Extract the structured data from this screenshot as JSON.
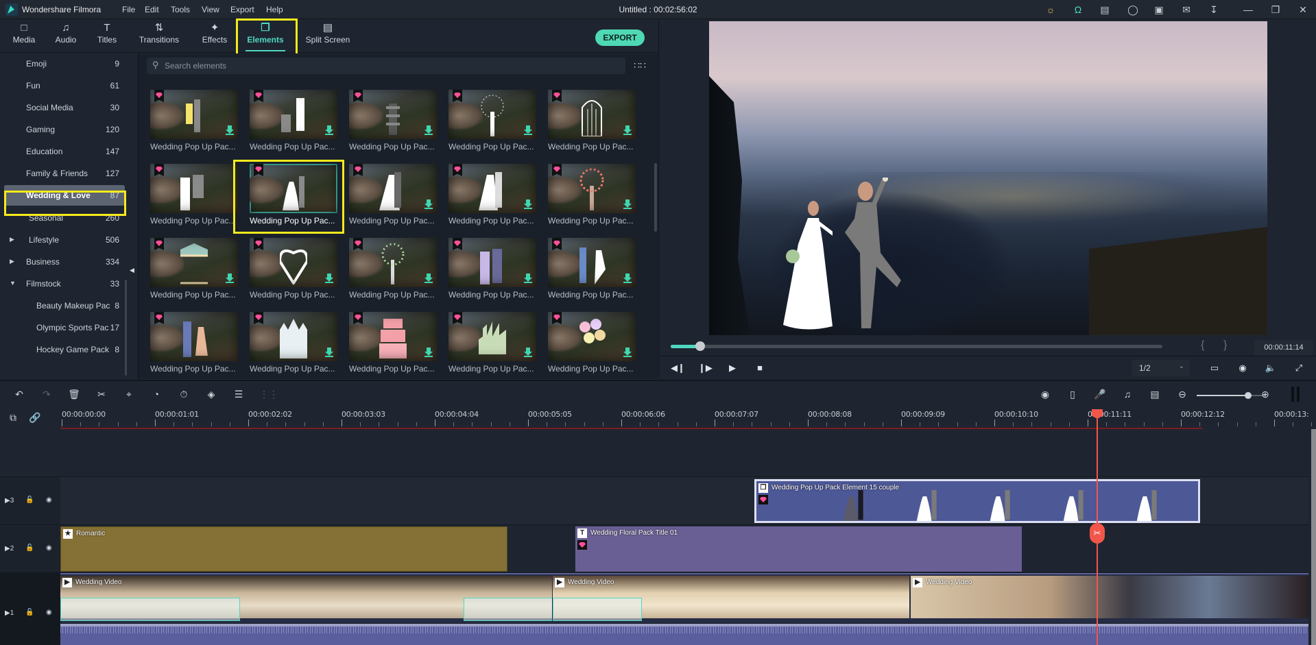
{
  "titlebar": {
    "app_name": "Wondershare Filmora",
    "menus": [
      "File",
      "Edit",
      "Tools",
      "View",
      "Export",
      "Help"
    ],
    "document_title": "Untitled : 00:02:56:02",
    "icons": [
      "lightbulb-icon",
      "headset-icon",
      "gift-icon",
      "account-icon",
      "save-icon",
      "mail-icon",
      "download-icon"
    ],
    "window_controls": [
      "minimize",
      "restore",
      "close"
    ]
  },
  "nav": {
    "tabs": [
      {
        "label": "Media",
        "icon": "folder-icon"
      },
      {
        "label": "Audio",
        "icon": "music-note-icon"
      },
      {
        "label": "Titles",
        "icon": "text-icon"
      },
      {
        "label": "Transitions",
        "icon": "transition-icon"
      },
      {
        "label": "Effects",
        "icon": "magic-icon"
      },
      {
        "label": "Elements",
        "icon": "elements-icon",
        "active": true
      },
      {
        "label": "Split Screen",
        "icon": "split-screen-icon"
      }
    ],
    "export_label": "EXPORT",
    "accent": "#4fd8c2",
    "highlight_color": "#f7ea1c"
  },
  "sidebar": {
    "categories": [
      {
        "label": "Emoji",
        "count": "9"
      },
      {
        "label": "Fun",
        "count": "61"
      },
      {
        "label": "Social Media",
        "count": "30"
      },
      {
        "label": "Gaming",
        "count": "120"
      },
      {
        "label": "Education",
        "count": "147"
      },
      {
        "label": "Family & Friends",
        "count": "127"
      },
      {
        "label": "Wedding & Love",
        "count": "87",
        "selected": true
      },
      {
        "label": "Seasonal",
        "count": "260"
      },
      {
        "label": "Lifestyle",
        "count": "506",
        "expander": "collapsed"
      },
      {
        "label": "Business",
        "count": "334",
        "expander": "collapsed"
      },
      {
        "label": "Filmstock",
        "count": "33",
        "expander": "expanded"
      },
      {
        "label": "Beauty Makeup Pac",
        "count": "8",
        "sub": true
      },
      {
        "label": "Olympic Sports Pac",
        "count": "17",
        "sub": true
      },
      {
        "label": "Hockey Game Pack",
        "count": "8",
        "sub": true
      }
    ]
  },
  "elements": {
    "search_placeholder": "Search elements",
    "search_value": "",
    "items": [
      {
        "name": "Wedding Pop Up Pac...",
        "figure": "couple-hug",
        "downloadable": true
      },
      {
        "name": "Wedding Pop Up Pac...",
        "figure": "proposal",
        "downloadable": true
      },
      {
        "name": "Wedding Pop Up Pac...",
        "figure": "pagoda",
        "downloadable": true
      },
      {
        "name": "Wedding Pop Up Pac...",
        "figure": "white-tree",
        "downloadable": true
      },
      {
        "name": "Wedding Pop Up Pac...",
        "figure": "birdcage",
        "downloadable": true
      },
      {
        "name": "Wedding Pop Up Pac...",
        "figure": "kimono-couple",
        "downloadable": false
      },
      {
        "name": "Wedding Pop Up Pac...",
        "figure": "couple-dance",
        "downloadable": false,
        "selected": true
      },
      {
        "name": "Wedding Pop Up Pac...",
        "figure": "couple-veil",
        "downloadable": true
      },
      {
        "name": "Wedding Pop Up Pac...",
        "figure": "bride-groom",
        "downloadable": true
      },
      {
        "name": "Wedding Pop Up Pac...",
        "figure": "blossom-tree",
        "downloadable": true
      },
      {
        "name": "Wedding Pop Up Pac...",
        "figure": "gazebo",
        "downloadable": true
      },
      {
        "name": "Wedding Pop Up Pac...",
        "figure": "heart",
        "downloadable": true
      },
      {
        "name": "Wedding Pop Up Pac...",
        "figure": "color-tree",
        "downloadable": true
      },
      {
        "name": "Wedding Pop Up Pac...",
        "figure": "yukata-couple",
        "downloadable": true
      },
      {
        "name": "Wedding Pop Up Pac...",
        "figure": "running-couple",
        "downloadable": true
      },
      {
        "name": "Wedding Pop Up Pac...",
        "figure": "holding-couple",
        "downloadable": false
      },
      {
        "name": "Wedding Pop Up Pac...",
        "figure": "castle",
        "downloadable": true
      },
      {
        "name": "Wedding Pop Up Pac...",
        "figure": "cake",
        "downloadable": true
      },
      {
        "name": "Wedding Pop Up Pac...",
        "figure": "skyline",
        "downloadable": true
      },
      {
        "name": "Wedding Pop Up Pac...",
        "figure": "balloons",
        "downloadable": true
      }
    ]
  },
  "preview": {
    "timecode": "00:00:11:14",
    "progress": 0.06,
    "quality": "1/2",
    "in_mark": "{",
    "out_mark": "}"
  },
  "timeline": {
    "zoom_level": 0.75,
    "ruler_labels": [
      "00:00:00:00",
      "00:00:01:01",
      "00:00:02:02",
      "00:00:03:03",
      "00:00:04:04",
      "00:00:05:05",
      "00:00:06:06",
      "00:00:07:07",
      "00:00:08:08",
      "00:00:09:09",
      "00:00:10:10",
      "00:00:11:11",
      "00:00:12:12",
      "00:00:13:"
    ],
    "tracks": [
      {
        "id": "3",
        "clips": [
          {
            "label": "Wedding Pop Up Pack Element 15 couple",
            "type": "element"
          }
        ]
      },
      {
        "id": "2",
        "clips": [
          {
            "label": "Romantic",
            "type": "effect"
          },
          {
            "label": "Wedding Floral Pack Title 01",
            "type": "title"
          }
        ]
      },
      {
        "id": "1",
        "clips": [
          {
            "label": "Wedding Video",
            "type": "video"
          },
          {
            "label": "Wedding Video",
            "type": "video"
          },
          {
            "label": "Wedding Video",
            "type": "video"
          }
        ]
      }
    ],
    "playhead_time": "00:00:11:11",
    "playhead_color": "#f2564b"
  }
}
